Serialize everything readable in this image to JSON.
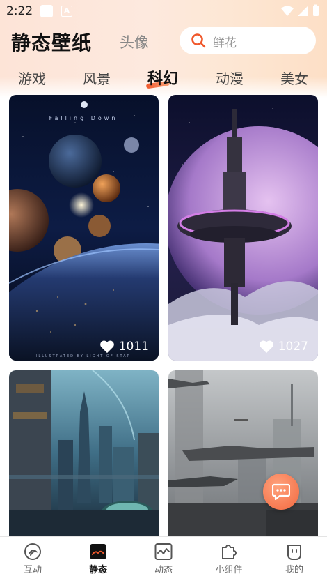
{
  "status_bar": {
    "time": "2:22"
  },
  "header": {
    "title": "静态壁纸",
    "avatar_tab": "头像",
    "search_placeholder": "鲜花"
  },
  "categories": [
    {
      "label": "游戏",
      "active": false
    },
    {
      "label": "风景",
      "active": false
    },
    {
      "label": "科幻",
      "active": true
    },
    {
      "label": "动漫",
      "active": false
    },
    {
      "label": "美女",
      "active": false
    }
  ],
  "cards": [
    {
      "likes": "1011",
      "title_text": "Falling Down",
      "footer_text": "ILLUSTRATED BY LIGHT OF STAR"
    },
    {
      "likes": "1027"
    },
    {},
    {}
  ],
  "bottom_nav": [
    {
      "label": "互动",
      "icon": "interaction-icon",
      "active": false
    },
    {
      "label": "静态",
      "icon": "image-icon",
      "active": true
    },
    {
      "label": "动态",
      "icon": "dynamic-icon",
      "active": false
    },
    {
      "label": "小组件",
      "icon": "puzzle-icon",
      "active": false
    },
    {
      "label": "我的",
      "icon": "profile-icon",
      "active": false
    }
  ],
  "colors": {
    "accent": "#f0582c",
    "fab": "#f47a52"
  }
}
